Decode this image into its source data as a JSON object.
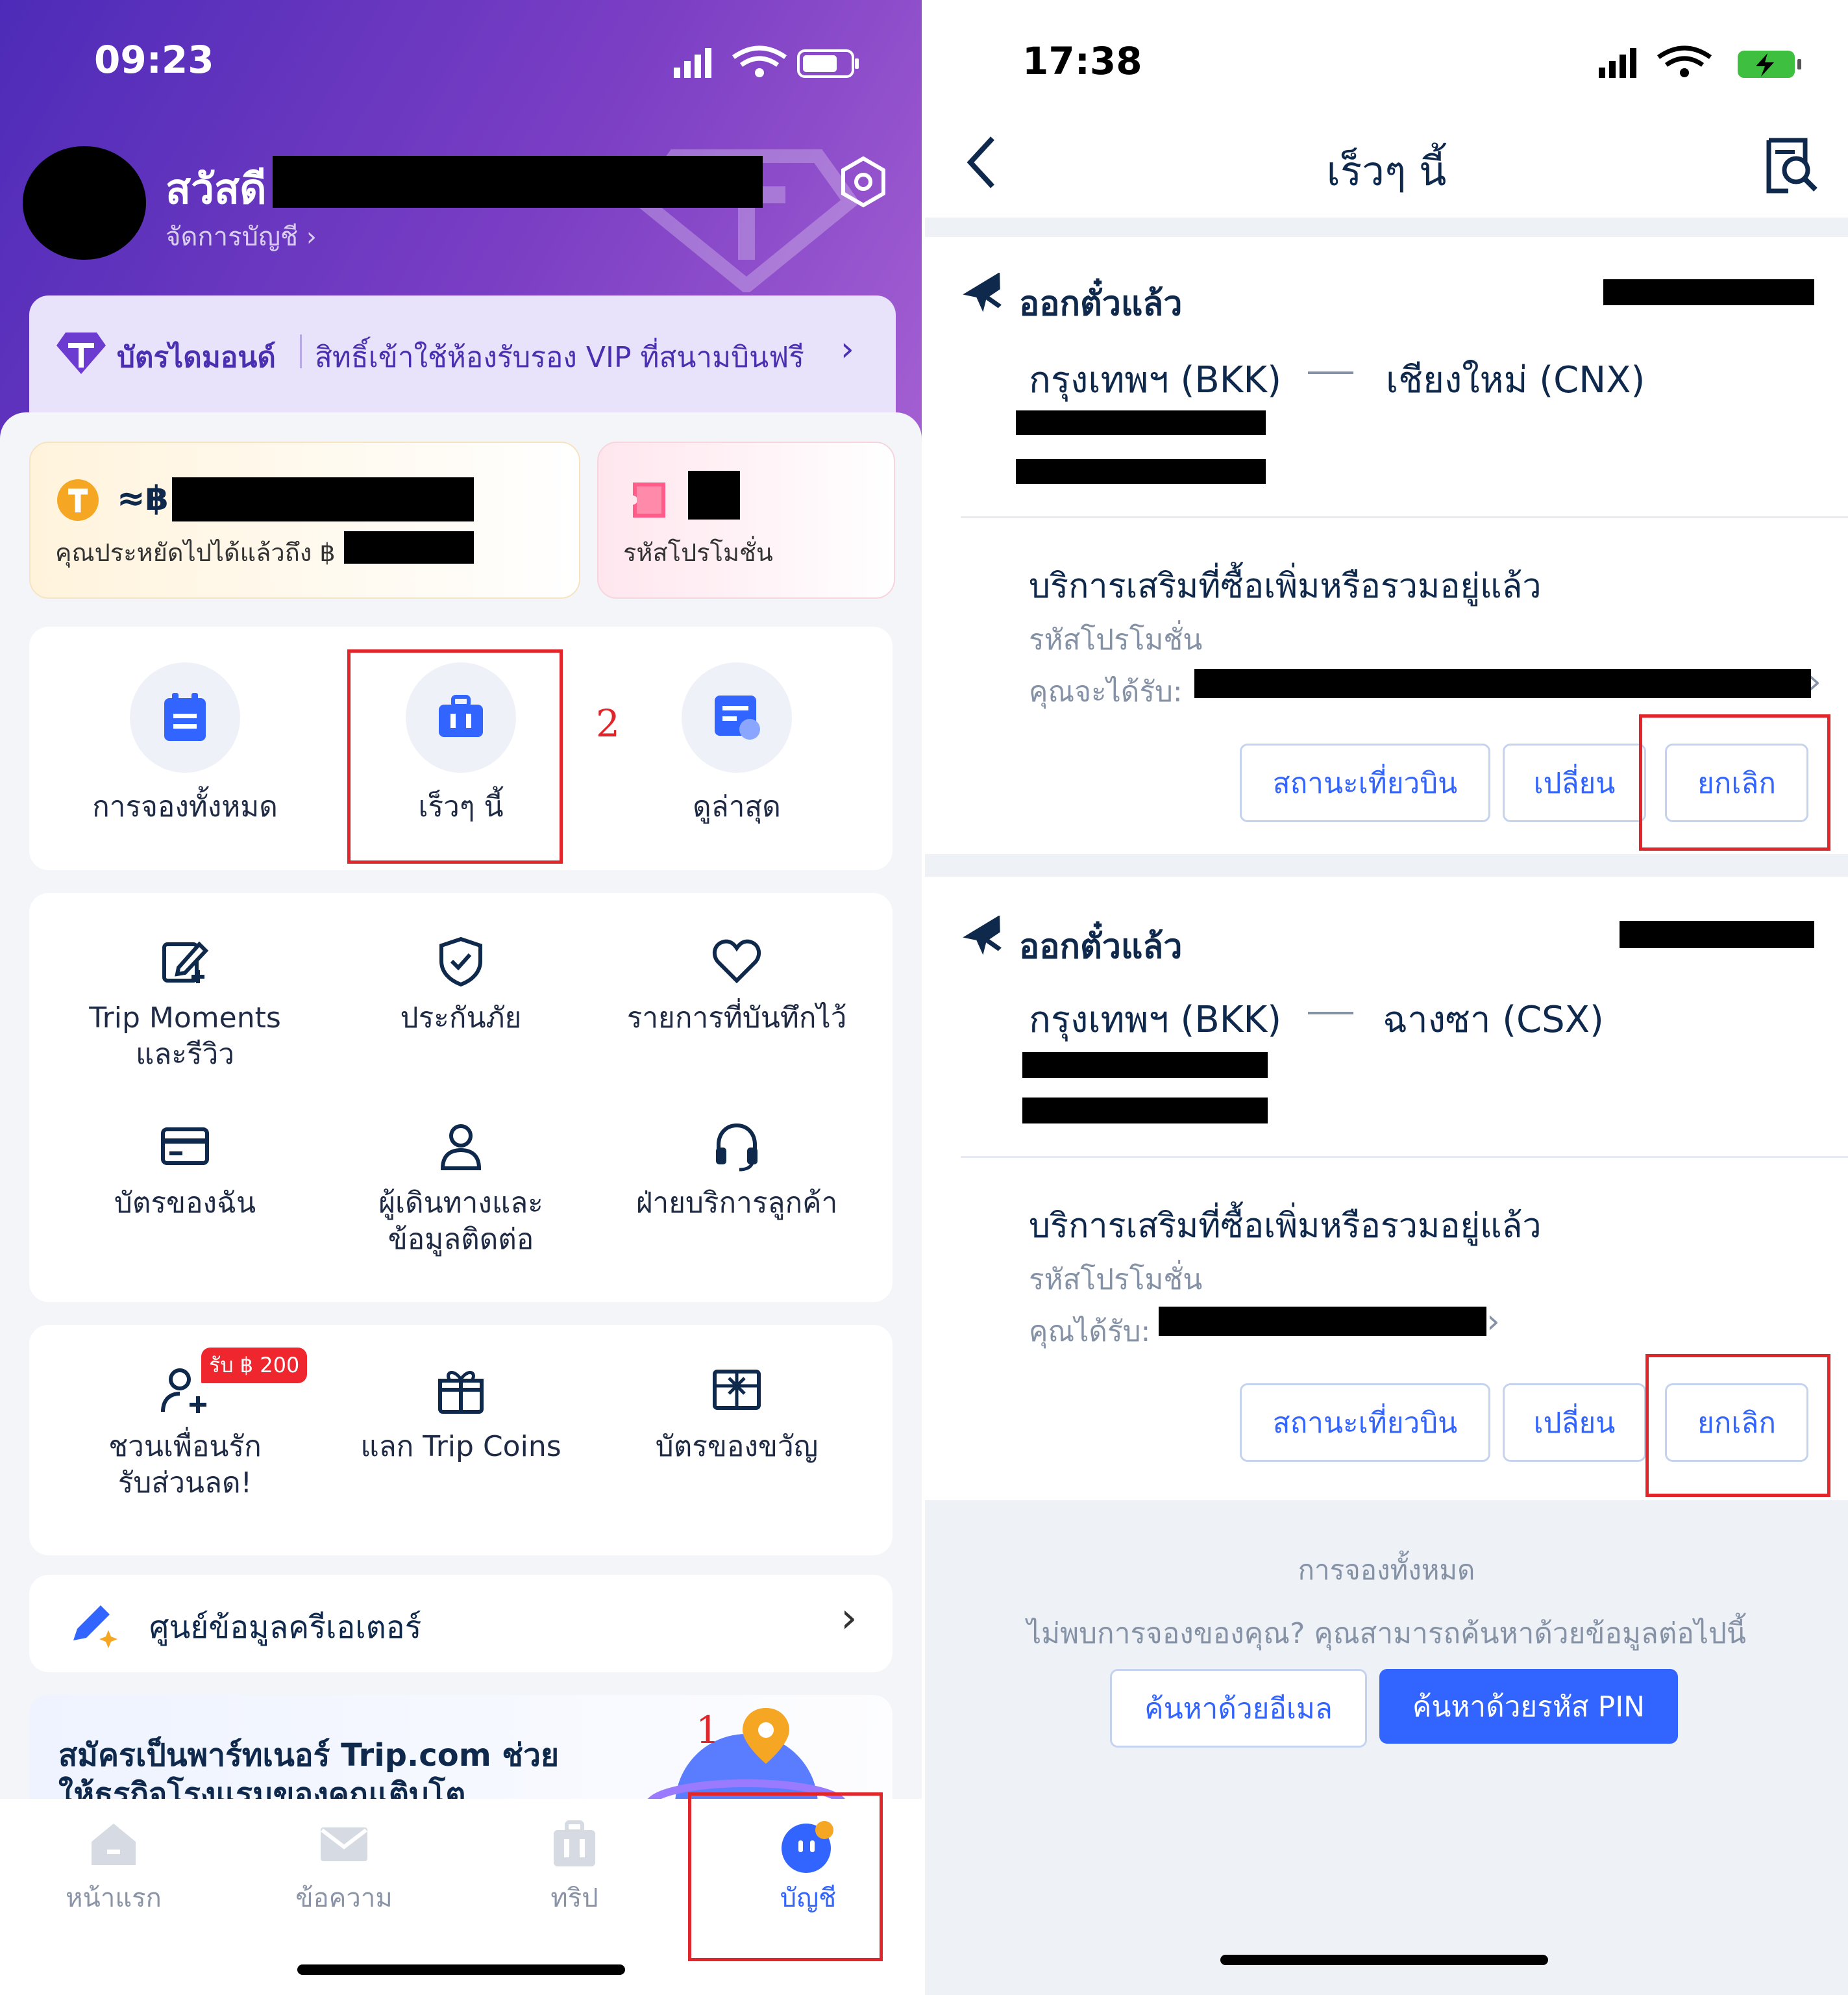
{
  "left": {
    "status_time": "09:23",
    "greeting": "สวัสดี",
    "manage_account": "จัดการบัญชี",
    "tier_name": "บัตรไดมอนด์",
    "tier_benefit": "สิทธิ์เข้าใช้ห้องรับรอง VIP ที่สนามบินฟรี",
    "coins_prefix": "≈฿",
    "saved_text": "คุณประหยัดไปได้แล้วถึง ฿",
    "promo_label": "รหัสโปรโมชั่น",
    "quick": {
      "all_bookings": "การจองทั้งหมด",
      "upcoming": "เร็วๆ นี้",
      "recently_viewed": "ดูล่าสุด"
    },
    "marker_1": "1",
    "marker_2": "2",
    "menu": {
      "trip_moments_l1": "Trip Moments",
      "trip_moments_l2": "และรีวิว",
      "insurance": "ประกันภัย",
      "saved": "รายการที่บันทึกไว้",
      "my_cards": "บัตรของฉัน",
      "travelers_l1": "ผู้เดินทางและ",
      "travelers_l2": "ข้อมูลติดต่อ",
      "customer_service": "ฝ่ายบริการลูกค้า"
    },
    "rewards": {
      "badge": "รับ ฿ 200",
      "invite_l1": "ชวนเพื่อนรัก",
      "invite_l2": "รับส่วนลด!",
      "redeem": "แลก Trip Coins",
      "gift_cards": "บัตรของขวัญ"
    },
    "creator_center": "ศูนย์ข้อมูลครีเอเตอร์",
    "partner_l1": "สมัครเป็นพาร์ทเนอร์ Trip.com ช่วย",
    "partner_l2": "ให้ธุรกิจโรงแรมของคุณเติบโต",
    "tabs": {
      "home": "หน้าแรก",
      "messages": "ข้อความ",
      "trips": "ทริป",
      "account": "บัญชี"
    }
  },
  "right": {
    "status_time": "17:38",
    "title": "เร็วๆ นี้",
    "bookings": [
      {
        "status": "ออกตั๋วแล้ว",
        "from": "กรุงเทพฯ (BKK)",
        "to": "เชียงใหม่ (CNX)",
        "svc_title": "บริการเสริมที่ซื้อเพิ่มหรือรวมอยู่แล้ว",
        "svc_promo": "รหัสโปรโมชั่น",
        "svc_get": "คุณจะได้รับ:",
        "btn_status": "สถานะเที่ยวบิน",
        "btn_change": "เปลี่ยน",
        "btn_cancel": "ยกเลิก"
      },
      {
        "status": "ออกตั๋วแล้ว",
        "from": "กรุงเทพฯ (BKK)",
        "to": "ฉางซา (CSX)",
        "svc_title": "บริการเสริมที่ซื้อเพิ่มหรือรวมอยู่แล้ว",
        "svc_promo": "รหัสโปรโมชั่น",
        "svc_get": "คุณได้รับ:",
        "btn_status": "สถานะเที่ยวบิน",
        "btn_change": "เปลี่ยน",
        "btn_cancel": "ยกเลิก"
      }
    ],
    "all_bookings": "การจองทั้งหมด",
    "not_found": "ไม่พบการจองของคุณ? คุณสามารถค้นหาด้วยข้อมูลต่อไปนี้",
    "search_email": "ค้นหาด้วยอีเมล",
    "search_pin": "ค้นหาด้วยรหัส PIN"
  },
  "colors": {
    "accent_blue": "#3264ff",
    "header_purple": "#6a35c2",
    "annotation_red": "#e0262b"
  }
}
